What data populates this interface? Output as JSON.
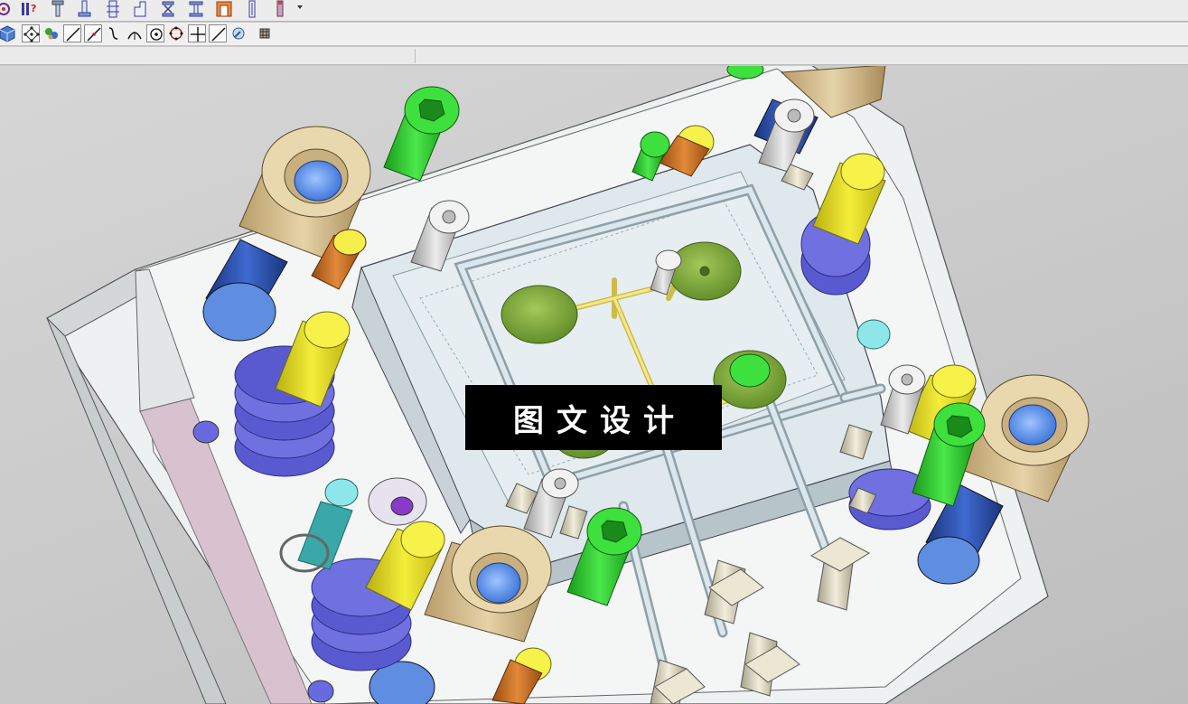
{
  "toolbar_top": {
    "buttons": [
      {
        "name": "view-icon"
      },
      {
        "name": "help-icon"
      },
      {
        "name": "ejector-pin-icon"
      },
      {
        "name": "sprue-bushing-icon"
      },
      {
        "name": "locating-ring-icon"
      },
      {
        "name": "slider-icon"
      },
      {
        "name": "lifter-icon"
      },
      {
        "name": "standard-part-icon"
      },
      {
        "name": "cavity-insert-icon"
      },
      {
        "name": "screw-icon"
      },
      {
        "name": "pin-icon"
      }
    ]
  },
  "toolbar_bottom": {
    "buttons": [
      {
        "name": "solid-cube-icon"
      },
      {
        "name": "snap-points-icon"
      },
      {
        "name": "transform-icon"
      },
      {
        "name": "line-icon"
      },
      {
        "name": "slash-line-icon"
      },
      {
        "name": "spline-icon"
      },
      {
        "name": "arc-icon"
      },
      {
        "name": "circle-center-icon"
      },
      {
        "name": "circle-icon"
      },
      {
        "name": "point-cross-icon"
      },
      {
        "name": "diagonal-line-icon"
      },
      {
        "name": "query-icon"
      },
      {
        "name": "grid-icon"
      }
    ]
  },
  "viewport": {
    "watermark_text": "图文设计",
    "colors": {
      "plate": "#e9eef0",
      "insert": "#d9e4e8",
      "guide_sleeve": "#d8c49a",
      "guide_pin": "#2b4fa8",
      "spring": "#6464d8",
      "return_pin": "#e6dc1e",
      "screw_green": "#2fcf2f",
      "screw_grey": "#cfcfcf",
      "runner": "#f1e07a",
      "gate_disk": "#7aa23a",
      "cooling_tube": "#b8c6cc",
      "fitting": "#d8d2bd",
      "stop_pin": "#c86e1e"
    }
  }
}
